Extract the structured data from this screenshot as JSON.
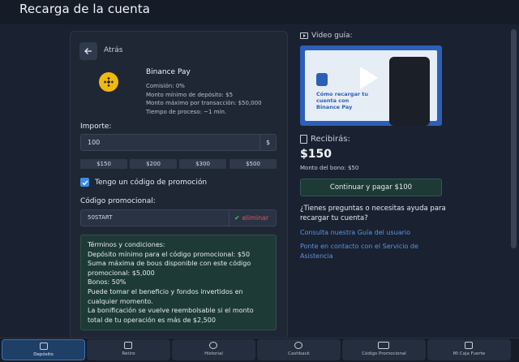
{
  "header": {
    "title": "Recarga de la cuenta"
  },
  "method": {
    "back_label": "Atrás",
    "name": "Binance Pay",
    "details": [
      "Comisión: 0%",
      "Monto mínimo de depósito: $5",
      "Monto máximo por transacción: $50,000",
      "Tiempo de proceso: ~1 min."
    ]
  },
  "amount": {
    "label": "Importe:",
    "value": "100",
    "currency": "$",
    "presets": [
      "$150",
      "$200",
      "$300",
      "$500"
    ]
  },
  "promo": {
    "checkbox_label": "Tengo un código de promoción",
    "checked": true,
    "code_label": "Código promocional:",
    "code_value": "50START",
    "remove_label": "eliminar"
  },
  "terms": {
    "lines": [
      "Términos y condiciones:",
      "Depósito mínimo para el código promocional: $50",
      "Suma máxima de bous disponible con este código promocional: $5,000",
      "Bonos: 50%",
      "Puede tomar el beneficio y fondos invertidos en cualquier momento.",
      "La bonificación se vuelve reembolsable si el monto total de tu operación es más de $2,500"
    ]
  },
  "video": {
    "label": "Video guía:",
    "caption": "Cómo recargar tu cuenta con Binance Pay"
  },
  "summary": {
    "receive_label": "Recibirás:",
    "receive_amount": "$150",
    "bonus_text": "Monto del bono: $50",
    "pay_button": "Continuar y pagar $100"
  },
  "help": {
    "question": "¿Tienes preguntas o necesitas ayuda para recargar tu cuenta?",
    "guide_link": "Consulta nuestra Guía del usuario",
    "contact_link": "Ponte en contacto con el Servicio de Asistencia"
  },
  "bottom_nav": {
    "items": [
      "Depósito",
      "Retiro",
      "Historial",
      "Cashback",
      "Código Promocional",
      "Mi Caja Fuerte"
    ],
    "active": "Depósito"
  },
  "colors": {
    "background": "#1a2130",
    "accent": "#3a8ee6",
    "success_bg": "#1d3a36",
    "danger": "#e05555",
    "binance": "#f0b90b"
  }
}
